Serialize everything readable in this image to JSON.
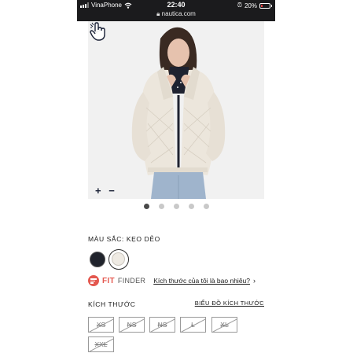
{
  "status_bar": {
    "carrier": "VinaPhone",
    "time": "22:40",
    "url": "nautica.com",
    "battery": "20%"
  },
  "gallery": {
    "zoom_controls": "+ −",
    "slide_count": 5,
    "active_slide": 1
  },
  "product": {
    "color_label": "MÀU SẮC: KẸO DẺO",
    "swatches": [
      {
        "name": "navy",
        "color": "#20232c",
        "selected": false
      },
      {
        "name": "cream",
        "color": "#eeeae3",
        "selected": true
      }
    ],
    "fit_finder": {
      "brand_fit": "FIT",
      "brand_finder": "FINDER",
      "link": "Kích thước của tôi là bao nhiêu?",
      "chevron": "›"
    },
    "size_label": "KÍCH THƯỚC",
    "size_chart_link": "BIỂU ĐỒ KÍCH THƯỚC",
    "sizes": [
      "XS",
      "NS",
      "NS",
      "L",
      "XL",
      "XXL"
    ]
  },
  "colors": {
    "accent_red": "#e4584f",
    "navy": "#1a2136",
    "status_bar_bg": "#1b1b1d"
  }
}
